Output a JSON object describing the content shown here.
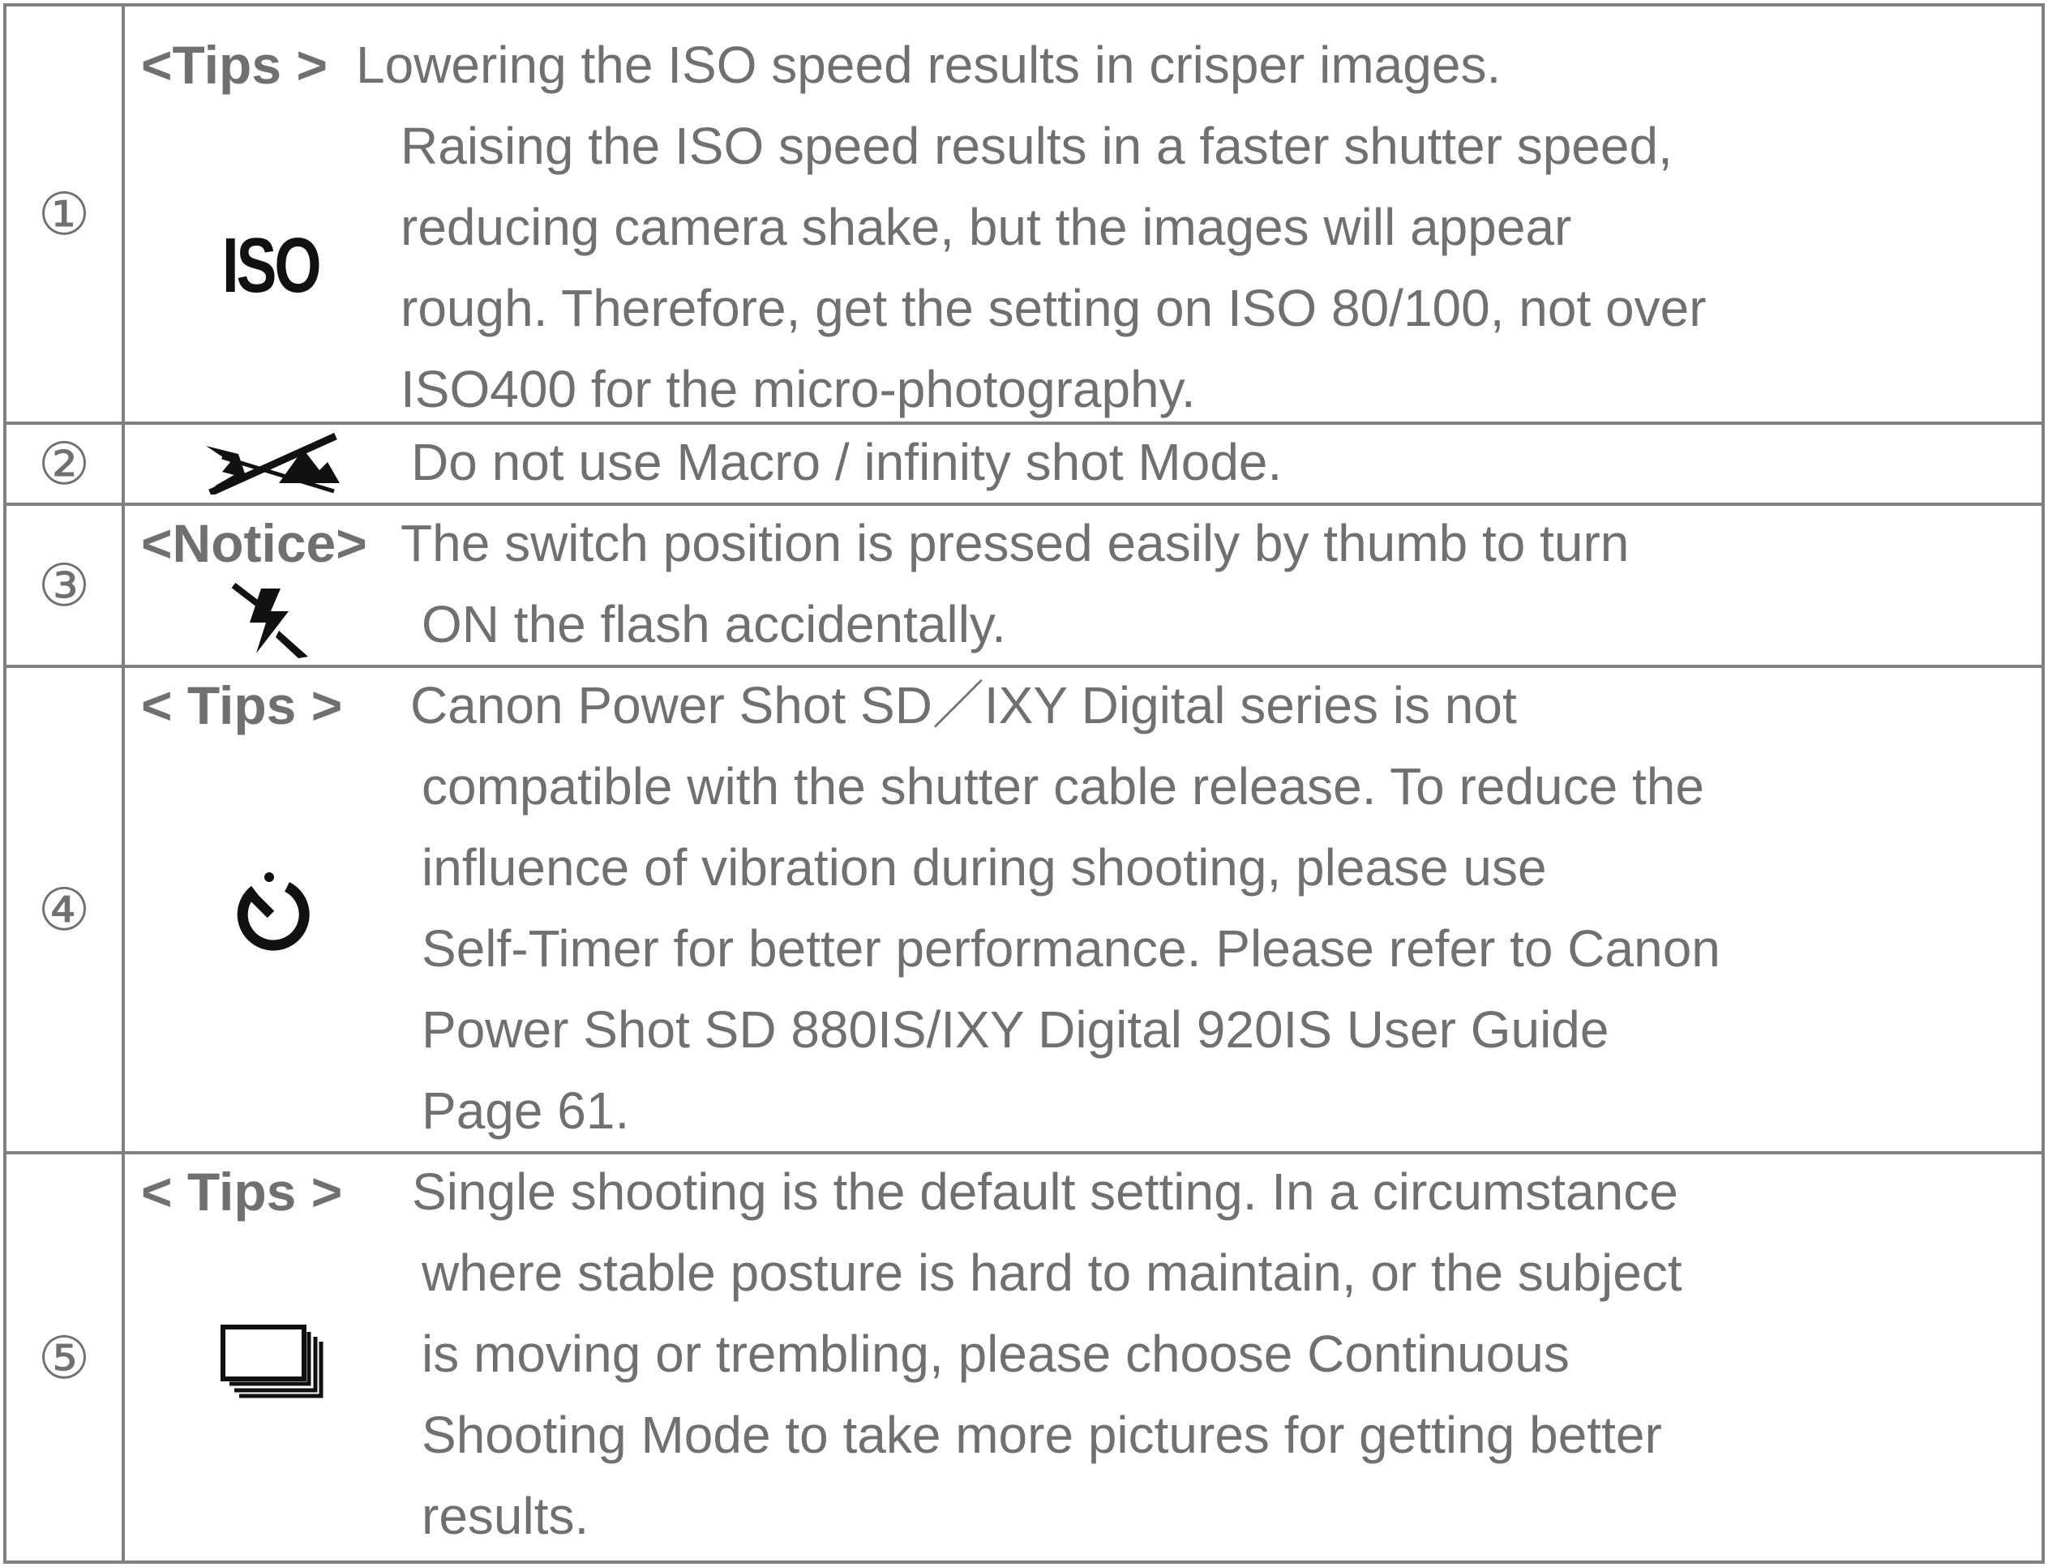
{
  "rows": [
    {
      "number": "①",
      "prefix": "<Tips >",
      "icon": "iso-icon",
      "icon_text": "ISO",
      "lines": [
        "Lowering the ISO speed results in crisper images.",
        "Raising the ISO speed results in a faster shutter speed,",
        "reducing camera shake, but the images will appear",
        "rough. Therefore, get the setting on ISO 80/100, not over",
        "ISO400 for the micro-photography."
      ]
    },
    {
      "number": "②",
      "prefix": "",
      "icon": "no-macro-infinity-icon",
      "lines": [
        "Do not use Macro / infinity shot Mode."
      ]
    },
    {
      "number": "③",
      "prefix": "<Notice>",
      "icon": "flash-on-icon",
      "lines": [
        "The switch position is pressed easily by thumb to turn",
        "ON the flash accidentally."
      ]
    },
    {
      "number": "④",
      "prefix": "< Tips >",
      "icon": "self-timer-icon",
      "lines": [
        "Canon Power Shot SD／IXY Digital series is not",
        "compatible with the shutter cable release. To reduce the",
        "influence of vibration during shooting, please use",
        "Self-Timer for better performance. Please refer to Canon",
        "Power Shot SD 880IS/IXY Digital 920IS User Guide",
        "Page 61."
      ]
    },
    {
      "number": "⑤",
      "prefix": "< Tips >",
      "icon": "continuous-shooting-icon",
      "lines": [
        "Single shooting is the default setting. In a circumstance",
        "where stable posture is hard to maintain, or the subject",
        "is moving or trembling, please choose Continuous",
        "Shooting Mode to take more pictures for getting better",
        "results."
      ]
    }
  ]
}
